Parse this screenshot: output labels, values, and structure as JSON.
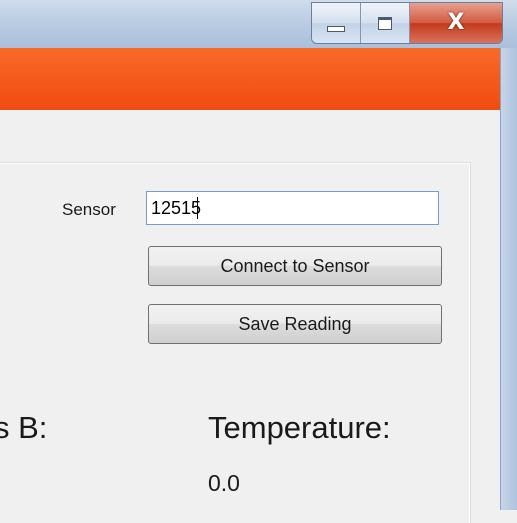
{
  "window": {
    "caption_buttons": {
      "minimize_icon": "minimize-icon",
      "maximize_icon": "maximize-icon",
      "close_glyph": "X"
    }
  },
  "banner": {
    "color": "#f04b10"
  },
  "form": {
    "sensor_label": "Sensor",
    "sensor_value": "12515",
    "connect_button": "Connect to Sensor",
    "save_button": "Save Reading",
    "partial_label": "s B:",
    "temperature_label": "Temperature:",
    "temperature_value": "0.0"
  }
}
